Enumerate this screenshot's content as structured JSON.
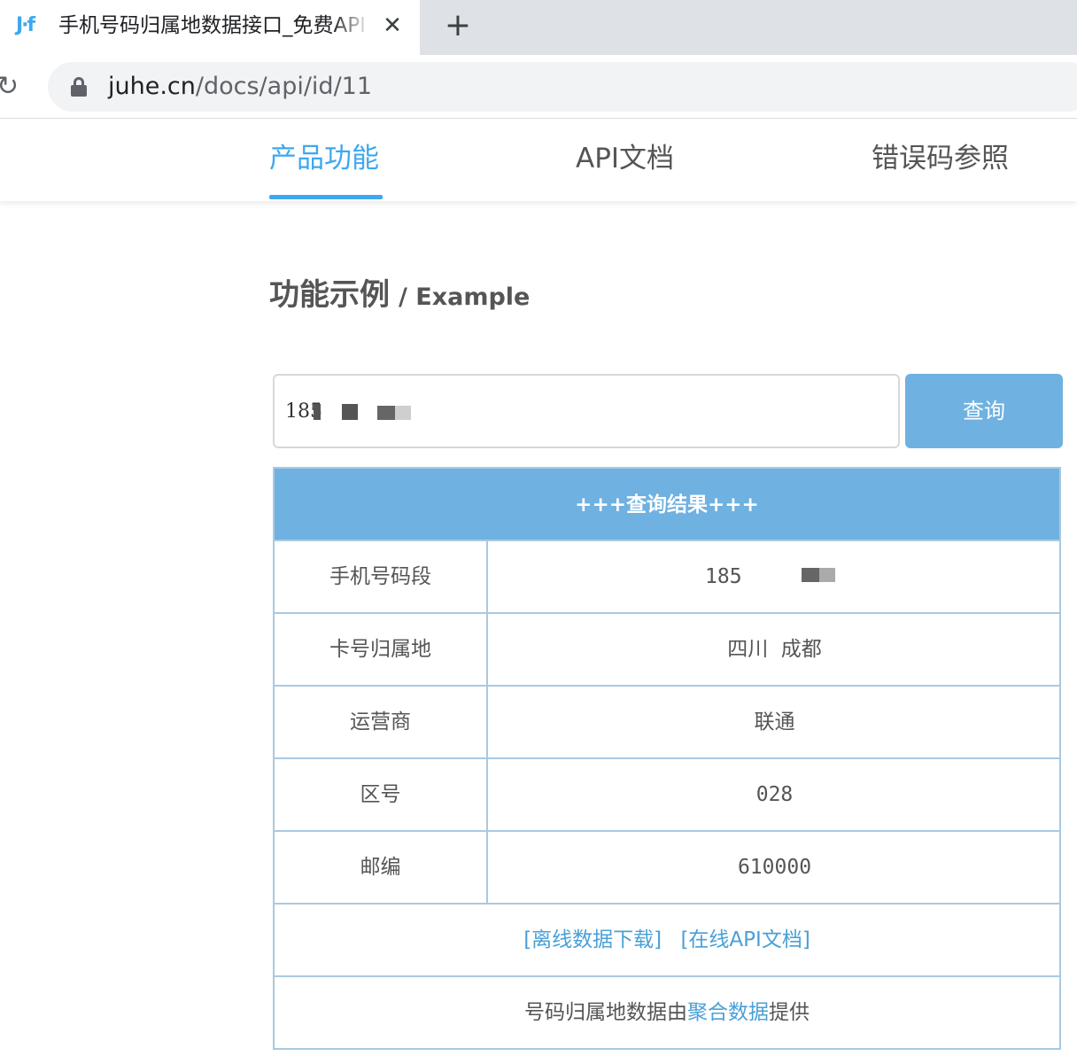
{
  "browser": {
    "tab_title": "手机号码归属地数据接口_免费API",
    "url_host": "juhe.cn",
    "url_path": "/docs/api/id/11"
  },
  "nav": {
    "tabs": [
      {
        "label": "产品功能",
        "active": true
      },
      {
        "label": "API文档",
        "active": false
      },
      {
        "label": "错误码参照",
        "active": false
      }
    ]
  },
  "heading": {
    "title": "功能示例",
    "subtitle": "/ Example"
  },
  "search": {
    "value": "185",
    "button_label": "查询"
  },
  "result": {
    "header": "+++查询结果+++",
    "rows": [
      {
        "label": "手机号码段",
        "value": "185"
      },
      {
        "label": "卡号归属地",
        "value": "四川  成都"
      },
      {
        "label": "运营商",
        "value": "联通"
      },
      {
        "label": "区号",
        "value": "028"
      },
      {
        "label": "邮编",
        "value": "610000"
      }
    ],
    "links": {
      "offline": "[离线数据下载]",
      "online": "[在线API文档]"
    },
    "credit": {
      "prefix": "号码归属地数据由",
      "provider": "聚合数据",
      "suffix": "提供"
    }
  },
  "colors": {
    "accent": "#3ea8ee",
    "table_header": "#6fb1e0",
    "table_border": "#a9c9e2",
    "link": "#4aa0d8"
  },
  "icons": {
    "favicon": "juhe-logo-icon",
    "close": "close-icon",
    "new_tab": "plus-icon",
    "reload": "reload-icon",
    "lock": "lock-icon"
  }
}
